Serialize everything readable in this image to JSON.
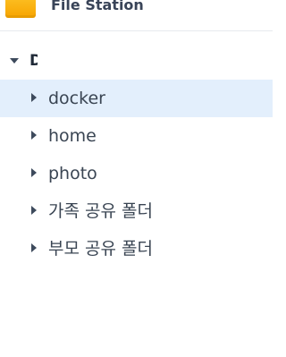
{
  "header": {
    "title": "File Station",
    "icon": "file-station-folder-icon",
    "icon_color": "#f9b800"
  },
  "tree": {
    "root_label": "DiskStation",
    "items": [
      {
        "label": "docker",
        "selected": true
      },
      {
        "label": "home",
        "selected": false
      },
      {
        "label": "photo",
        "selected": false
      },
      {
        "label": "가족 공유 폴더",
        "selected": false
      },
      {
        "label": "부모 공유 폴더",
        "selected": false
      }
    ]
  },
  "colors": {
    "selection": "#e3effc",
    "text": "#3a4553"
  }
}
